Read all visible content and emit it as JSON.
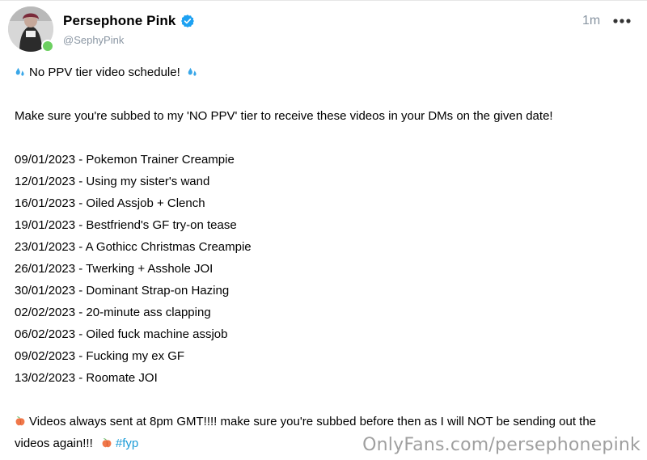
{
  "post": {
    "author": {
      "name": "Persephone Pink",
      "handle": "@SephyPink",
      "verified": true,
      "online": true
    },
    "timestamp": "1m",
    "more_icon": "more-horizontal-icon",
    "lines": {
      "heading": "No PPV tier video schedule!",
      "intro": "Make sure you're subbed to my 'NO PPV' tier to receive these videos in your DMs on the given date!",
      "schedule": [
        "09/01/2023 - Pokemon Trainer Creampie",
        "12/01/2023 - Using my sister's wand",
        "16/01/2023 - Oiled Assjob  + Clench",
        "19/01/2023 - Bestfriend's GF try-on tease",
        "23/01/2023 - A Gothicc Christmas Creampie",
        "26/01/2023 - Twerking + Asshole JOI",
        "30/01/2023 - Dominant Strap-on Hazing",
        "02/02/2023 - 20-minute ass clapping",
        "06/02/2023 - Oiled fuck machine assjob",
        "09/02/2023 - Fucking my ex GF",
        "13/02/2023 - Roomate JOI"
      ],
      "footer_line1": "Videos always sent at 8pm GMT!!!! make sure you're subbed before then as I will NOT be sending out the",
      "footer_line2": "videos again!!!",
      "hashtag": "#fyp"
    }
  },
  "watermark": "OnlyFans.com/persephonepink",
  "colors": {
    "verified_blue": "#1da1f2",
    "hashtag_blue": "#1a9bd7",
    "muted_gray": "#8a96a3",
    "online_green": "#6ccf60"
  }
}
